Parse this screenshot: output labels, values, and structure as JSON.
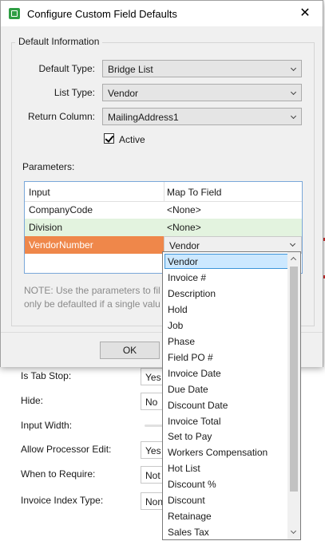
{
  "dialog": {
    "title": "Configure Custom Field Defaults",
    "group_title": "Default Information",
    "default_type": {
      "label": "Default Type:",
      "value": "Bridge List"
    },
    "list_type": {
      "label": "List Type:",
      "value": "Vendor"
    },
    "return_column": {
      "label": "Return Column:",
      "value": "MailingAddress1"
    },
    "active": {
      "label": "Active",
      "checked": true
    },
    "parameters_label": "Parameters:",
    "grid": {
      "headers": [
        "Input",
        "Map To Field"
      ],
      "rows": [
        {
          "input": "CompanyCode",
          "map": "<None>"
        },
        {
          "input": "Division",
          "map": "<None>"
        },
        {
          "input": "VendorNumber",
          "map": "Vendor"
        }
      ]
    },
    "note_line1": "NOTE: Use the parameters to filte",
    "note_line2": "only be defaulted if a single value",
    "ok_label": "OK"
  },
  "dropdown": {
    "selected": "Vendor",
    "items": [
      "Vendor",
      "Invoice #",
      "Description",
      "Hold",
      "Job",
      "Phase",
      "Field PO #",
      "Invoice Date",
      "Due Date",
      "Discount Date",
      "Invoice Total",
      "Set to Pay",
      "Workers Compensation",
      "Hot List",
      "Discount %",
      "Discount",
      "Retainage",
      "Sales Tax"
    ]
  },
  "background": {
    "rows": [
      {
        "label": "Is Tab Stop:",
        "value": "Yes"
      },
      {
        "label": "Hide:",
        "value": "No"
      },
      {
        "label": "Input Width:",
        "value": ""
      },
      {
        "label": "Allow Processor Edit:",
        "value": "Yes"
      },
      {
        "label": "When to Require:",
        "value": "Not"
      },
      {
        "label": "Invoice Index Type:",
        "value": "Non"
      }
    ]
  },
  "colors": {
    "selected_row": "#ef874a",
    "alt_row": "#e3f3df",
    "grid_border": "#7aa7d9",
    "dropdown_selection": "#cce8ff",
    "edge_marks": "#d23030"
  },
  "icons": {
    "app": "app-icon",
    "close": "close-icon"
  }
}
